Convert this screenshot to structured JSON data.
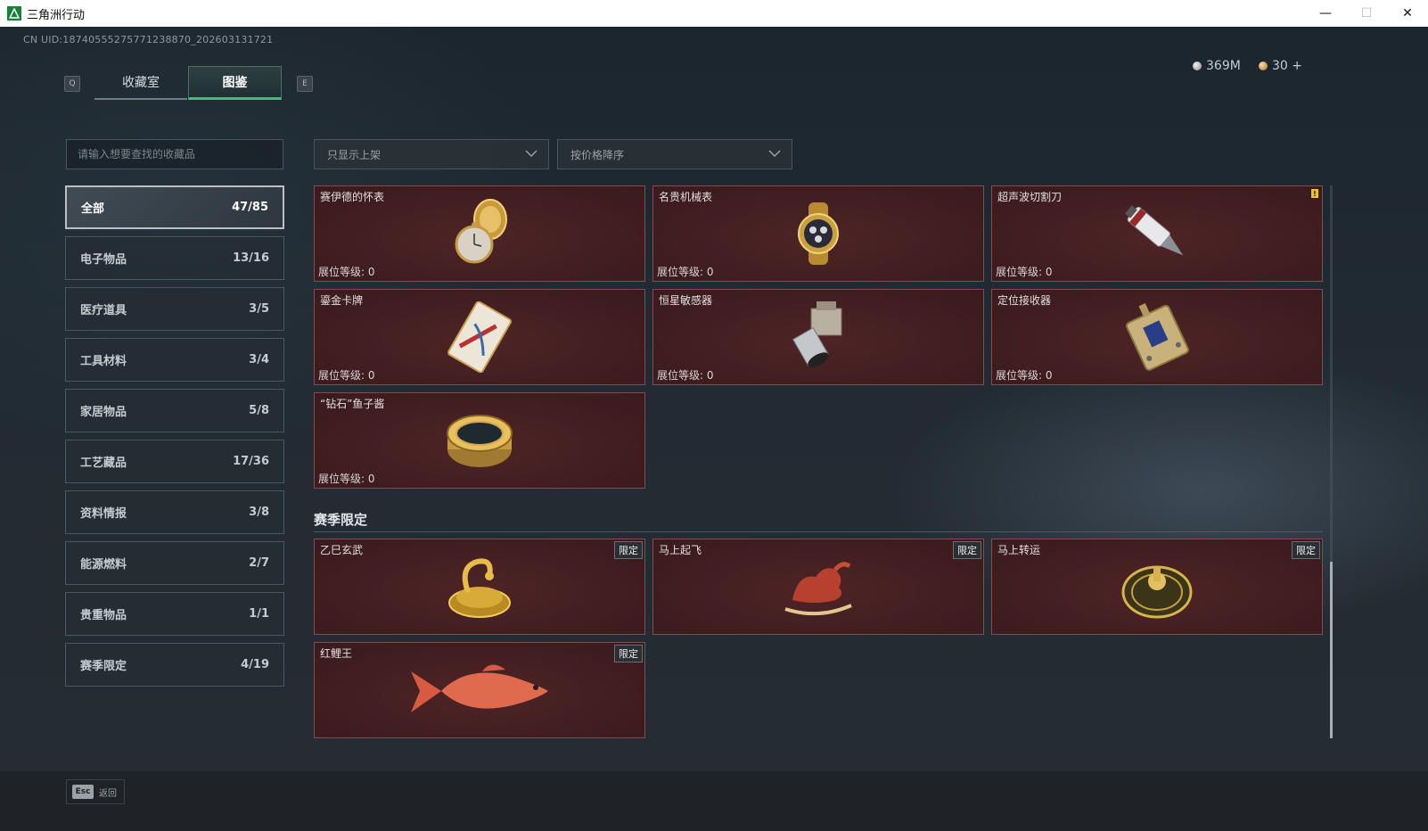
{
  "window": {
    "title": "三角洲行动",
    "minimize": "—",
    "maximize": "☐",
    "close": "✕"
  },
  "uid": "CN UID:18740555275771238870_202603131721",
  "currency": {
    "silver": "369M",
    "gold": "30 +"
  },
  "tabs": {
    "prev_key": "Q",
    "next_key": "E",
    "items": [
      {
        "label": "收藏室"
      },
      {
        "label": "图鉴"
      }
    ]
  },
  "search": {
    "placeholder": "请输入想要查找的收藏品"
  },
  "filters": {
    "shelf": "只显示上架",
    "sort": "按价格降序"
  },
  "categories": [
    {
      "label": "全部",
      "count": "47/85"
    },
    {
      "label": "电子物品",
      "count": "13/16"
    },
    {
      "label": "医疗道具",
      "count": "3/5"
    },
    {
      "label": "工具材料",
      "count": "3/4"
    },
    {
      "label": "家居物品",
      "count": "5/8"
    },
    {
      "label": "工艺藏品",
      "count": "17/36"
    },
    {
      "label": "资料情报",
      "count": "3/8"
    },
    {
      "label": "能源燃料",
      "count": "2/7"
    },
    {
      "label": "贵重物品",
      "count": "1/1"
    },
    {
      "label": "赛季限定",
      "count": "4/19"
    }
  ],
  "items": [
    {
      "name": "赛伊德的怀表",
      "level": "展位等级: 0"
    },
    {
      "name": "名贵机械表",
      "level": "展位等级: 0"
    },
    {
      "name": "超声波切割刀",
      "level": "展位等级: 0",
      "warning": "!"
    },
    {
      "name": "鎏金卡牌",
      "level": "展位等级: 0"
    },
    {
      "name": "恒星敏感器",
      "level": "展位等级: 0"
    },
    {
      "name": "定位接收器",
      "level": "展位等级: 0"
    },
    {
      "name": "“钻石”鱼子酱",
      "level": "展位等级: 0"
    }
  ],
  "season_section": {
    "title": "赛季限定",
    "badge": "限定"
  },
  "season_items": [
    {
      "name": "乙巳玄武"
    },
    {
      "name": "马上起飞"
    },
    {
      "name": "马上转运"
    },
    {
      "name": "红鲤王"
    }
  ],
  "footer": {
    "esc_key": "Esc",
    "esc_label": "返回"
  },
  "colors": {
    "accent": "#35c27d",
    "card_bg": "#3f1d1f",
    "card_border": "#7d4f52"
  }
}
